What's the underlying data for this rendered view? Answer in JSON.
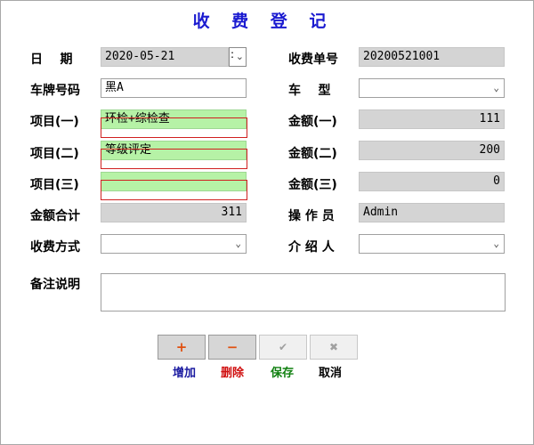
{
  "title": "收 费 登 记",
  "labels": {
    "date": "日    期",
    "receipt_no": "收费单号",
    "plate": "车牌号码",
    "car_type": "车    型",
    "item1": "项目(一)",
    "amount1": "金额(一)",
    "item2": "项目(二)",
    "amount2": "金额(二)",
    "item3": "项目(三)",
    "amount3": "金额(三)",
    "total": "金额合计",
    "operator": "操 作 员",
    "pay_method": "收费方式",
    "referrer": "介 绍 人",
    "remark": "备注说明"
  },
  "values": {
    "date": "2020-05-21",
    "receipt_no": "20200521001",
    "plate": "黑A",
    "car_type": "",
    "item1": "环检+综检查",
    "amount1": "111",
    "item2": "等级评定",
    "amount2": "200",
    "item3": "",
    "amount3": "0",
    "total": "311",
    "operator": "Admin",
    "pay_method": "",
    "referrer": "",
    "remark": ""
  },
  "buttons": {
    "add_symbol": "+",
    "add_label": "增加",
    "delete_symbol": "−",
    "delete_label": "删除",
    "save_symbol": "✔",
    "save_label": "保存",
    "cancel_symbol": "✖",
    "cancel_label": "取消"
  },
  "colors": {
    "title": "#1a1ad0",
    "add": "#1a1aa0",
    "delete": "#d01010",
    "save": "#108010",
    "cancel": "#000000"
  }
}
